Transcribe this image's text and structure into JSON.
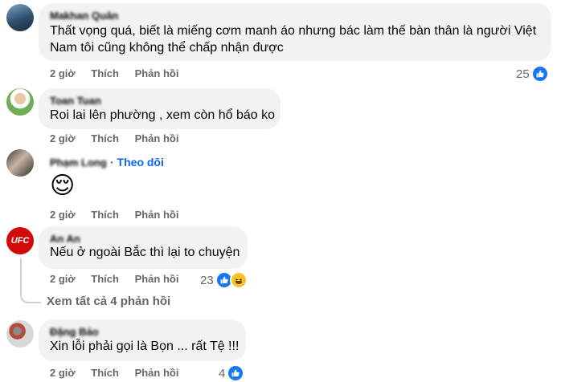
{
  "comments": [
    {
      "author": "Makhan Quân",
      "text_line1": "Thất vọng quá, biết là miếng cơm manh áo nhưng bác làm thế bàn thân là người Việt",
      "text_line2": "Nam tôi cũng không thể chấp nhận được",
      "time": "2 giờ",
      "like": "Thích",
      "reply": "Phản hồi",
      "reaction_count": "25",
      "reactions": [
        "like"
      ]
    },
    {
      "author": "Toan Tuan",
      "text_line1": "Roi lai lên phường , xem còn hổ báo ko",
      "time": "2 giờ",
      "like": "Thích",
      "reply": "Phản hồi"
    },
    {
      "author": "Phạm Long",
      "follow": "· Theo dõi",
      "emoji": "😌",
      "time": "2 giờ",
      "like": "Thích",
      "reply": "Phản hồi"
    },
    {
      "author": "An An",
      "avatar_text": "UFC",
      "text_line1": "Nếu ở ngoài Bắc thì lại to chuyện",
      "time": "2 giờ",
      "like": "Thích",
      "reply": "Phản hồi",
      "reaction_count": "23",
      "reactions": [
        "like",
        "haha"
      ]
    },
    {
      "author": "Đặng Bảo",
      "text_line1": "Xin lỗi phải gọi là Bọn ... rất Tệ !!!",
      "time": "2 giờ",
      "like": "Thích",
      "reply": "Phản hồi",
      "reaction_count": "4",
      "reactions": [
        "like"
      ]
    }
  ],
  "view_all_replies": "Xem tất cả 4 phản hồi",
  "colors": {
    "bubble": "#f0f2f5",
    "meta": "#65676b",
    "link": "#0866ff",
    "like": "#1877f2",
    "ufc": "#d20a0a"
  }
}
